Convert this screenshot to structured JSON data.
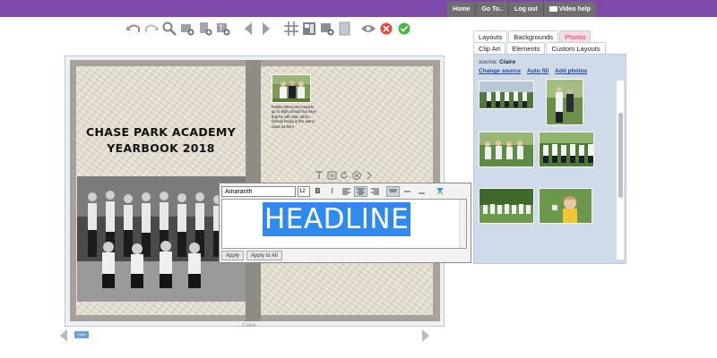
{
  "top_nav": [
    "Home",
    "Go To..",
    "Log out",
    "Video help"
  ],
  "toolbar": {
    "icons": [
      "undo-icon",
      "redo-icon",
      "zoom-icon",
      "add-photo-icon",
      "add-page-icon",
      "add-text-icon",
      "prev-page-icon",
      "next-page-icon",
      "grid-icon",
      "layout-icon",
      "add-image-icon",
      "background-icon",
      "preview-eye-icon",
      "cancel-icon",
      "confirm-icon"
    ]
  },
  "book": {
    "title_line1": "CHASE PARK ACADEMY",
    "title_line2": "YEARBOOK 2018",
    "small_text": "Robert West can't wait to go to high school but says that he will miss all his friends being in the same class as him!",
    "caption": "Claire",
    "page_thumb": "Cover"
  },
  "text_editor": {
    "font": "Amaranth",
    "size": "12",
    "headline": "HEADLINE",
    "apply_label": "Apply",
    "apply_all_label": "Apply to All",
    "bold_label": "B",
    "italic_label": "I"
  },
  "side_panel": {
    "tabs_row1": [
      "Layouts",
      "Backgrounds",
      "Photos"
    ],
    "tabs_row2": [
      "Clip Art",
      "Elements",
      "Custom Layouts"
    ],
    "active_tab": "Photos",
    "source_label": "source:",
    "source_value": "Claire",
    "links": [
      "Change source",
      "Auto fill",
      "Add photos"
    ]
  },
  "colors": {
    "header_purple": "#7d4aa8",
    "panel_blue": "#cfdbe8",
    "selection_blue": "#2f8af0",
    "active_tab_pink": "#d13a6a"
  }
}
